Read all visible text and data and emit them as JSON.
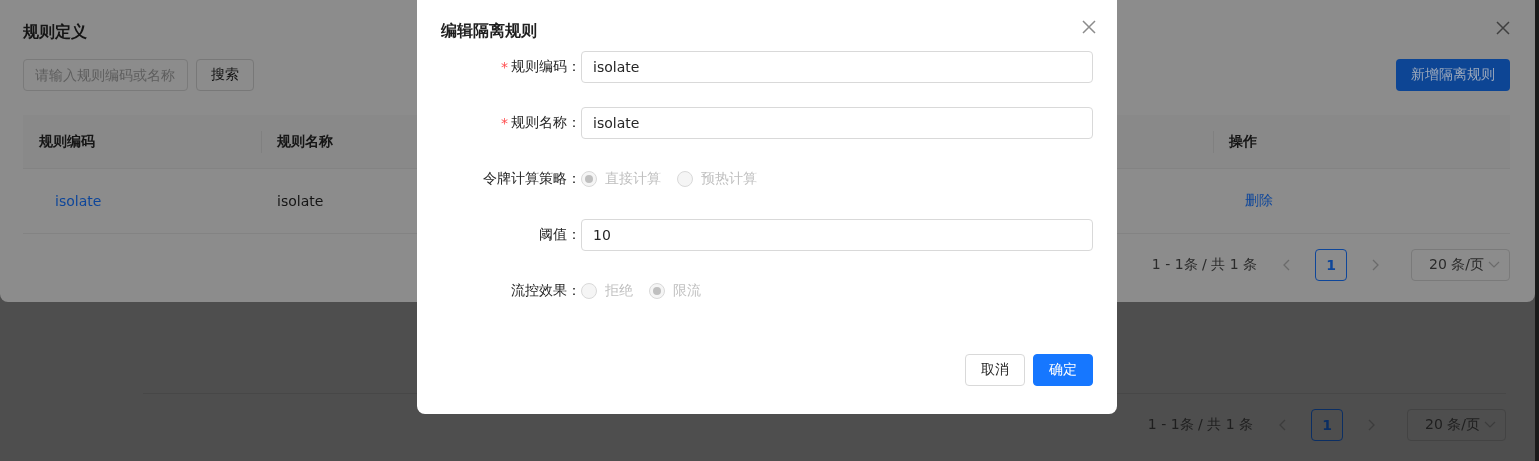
{
  "page": {
    "pagination": {
      "summary": "1 - 1条 / 共 1 条",
      "pages": [
        {
          "label": "1",
          "selected": true
        }
      ],
      "page_size": "20 条/页"
    }
  },
  "drawer": {
    "title": "规则定义",
    "search": {
      "placeholder": "请输入规则编码或名称"
    },
    "search_button": "搜索",
    "add_button": "新增隔离规则",
    "table": {
      "columns": [
        "规则编码",
        "规则名称",
        "操作"
      ],
      "rows": [
        {
          "code": "isolate",
          "name": "isolate",
          "action": "删除"
        }
      ]
    },
    "pagination": {
      "summary": "1 - 1条 / 共 1 条",
      "pages": [
        {
          "label": "1",
          "selected": true
        }
      ],
      "page_size": "20 条/页"
    }
  },
  "modal": {
    "title": "编辑隔离规则",
    "fields": [
      {
        "kind": "input",
        "required_mark": "*",
        "label": "规则编码：",
        "value": "isolate"
      },
      {
        "kind": "input",
        "required_mark": "*",
        "label": "规则名称：",
        "value": "isolate"
      },
      {
        "kind": "radio",
        "label": "令牌计算策略：",
        "disabled": true,
        "options": [
          {
            "label": "直接计算",
            "selected": true
          },
          {
            "label": "预热计算",
            "selected": false
          }
        ]
      },
      {
        "kind": "input",
        "label": "阈值：",
        "value": "10"
      },
      {
        "kind": "radio",
        "label": "流控效果：",
        "disabled": true,
        "options": [
          {
            "label": "拒绝",
            "selected": false
          },
          {
            "label": "限流",
            "selected": true
          }
        ]
      }
    ],
    "buttons": [
      {
        "label": "取消",
        "primary": false
      },
      {
        "label": "确定",
        "primary": true
      }
    ]
  }
}
